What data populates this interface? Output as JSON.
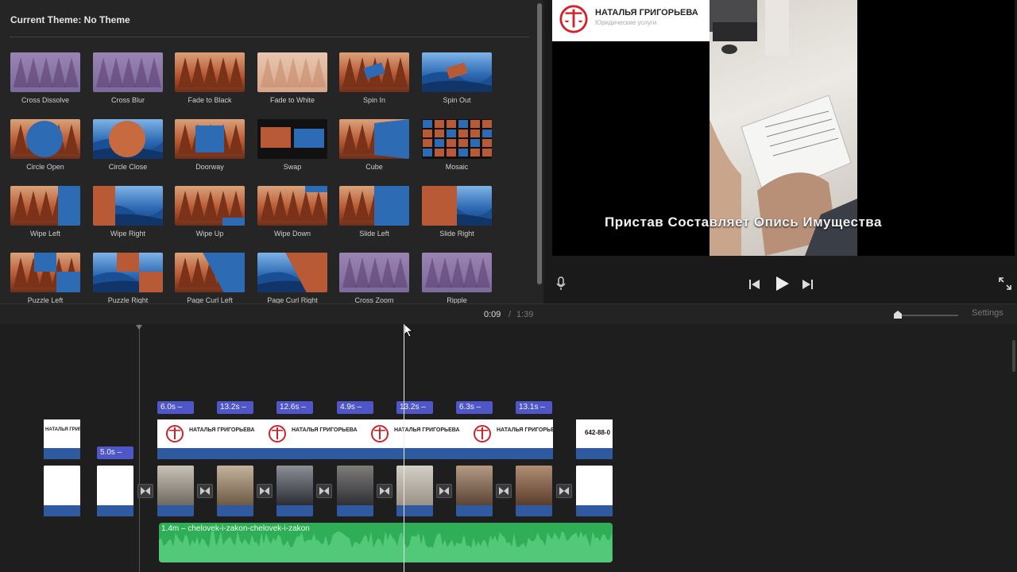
{
  "browser": {
    "theme_title": "Current Theme: No Theme",
    "transitions": [
      {
        "label": "Cross Dissolve",
        "icon": "cross-dissolve"
      },
      {
        "label": "Cross Blur",
        "icon": "cross-blur"
      },
      {
        "label": "Fade to Black",
        "icon": "fade-to-black"
      },
      {
        "label": "Fade to White",
        "icon": "fade-to-white"
      },
      {
        "label": "Spin In",
        "icon": "spin-in"
      },
      {
        "label": "Spin Out",
        "icon": "spin-out"
      },
      {
        "label": "Circle Open",
        "icon": "circle-open"
      },
      {
        "label": "Circle Close",
        "icon": "circle-close"
      },
      {
        "label": "Doorway",
        "icon": "doorway"
      },
      {
        "label": "Swap",
        "icon": "swap"
      },
      {
        "label": "Cube",
        "icon": "cube"
      },
      {
        "label": "Mosaic",
        "icon": "mosaic"
      },
      {
        "label": "Wipe Left",
        "icon": "wipe-left"
      },
      {
        "label": "Wipe Right",
        "icon": "wipe-right"
      },
      {
        "label": "Wipe Up",
        "icon": "wipe-up"
      },
      {
        "label": "Wipe Down",
        "icon": "wipe-down"
      },
      {
        "label": "Slide Left",
        "icon": "slide-left"
      },
      {
        "label": "Slide Right",
        "icon": "slide-right"
      },
      {
        "label": "Puzzle Left",
        "icon": "puzzle-left"
      },
      {
        "label": "Puzzle Right",
        "icon": "puzzle-right"
      },
      {
        "label": "Page Curl Left",
        "icon": "page-curl-left"
      },
      {
        "label": "Page Curl Right",
        "icon": "page-curl-right"
      },
      {
        "label": "Cross Zoom",
        "icon": "cross-zoom"
      },
      {
        "label": "Ripple",
        "icon": "ripple"
      }
    ]
  },
  "viewer": {
    "logo_name": "НАТАЛЬЯ ГРИГОРЬЕВА",
    "logo_sub": "Юридические услуги",
    "subtitle": "Пристав Составляет Опись Имущества",
    "icons": [
      "microphone-icon",
      "skip-back-icon",
      "play-icon",
      "skip-forward-icon",
      "fullscreen-icon"
    ]
  },
  "timebar": {
    "current": "0:09",
    "separator": "/",
    "total": "1:39",
    "settings_label": "Settings"
  },
  "timeline": {
    "title_clip_text": "НАТАЛЬЯ ГРИГОРЬЕВА",
    "end_title_text": "642-88-0",
    "durations": [
      "6.0s –",
      "13.2s –",
      "12.6s –",
      "4.9s –",
      "13.2s –",
      "6.3s –",
      "13.1s –",
      "5.0s –"
    ],
    "audio_label": "1.4m – chelovek-i-zakon-chelovek-i-zakon",
    "audio_color": "#2fae57",
    "clip_color": "#2f5aa0",
    "badge_color": "#4f56c8"
  }
}
